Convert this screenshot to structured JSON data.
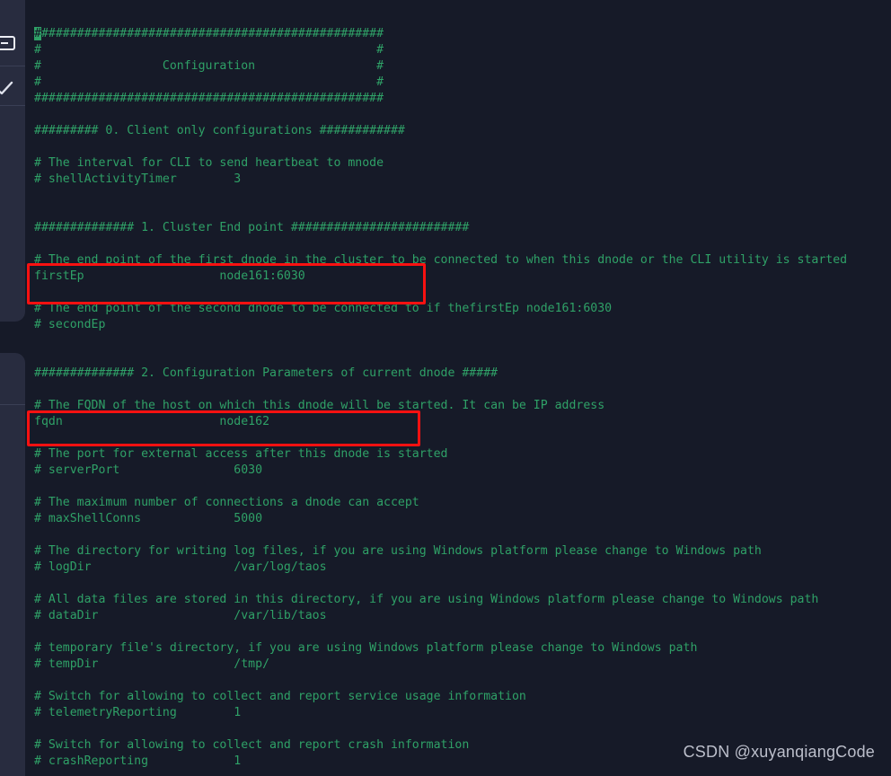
{
  "window": {
    "background_color": "#161a28",
    "sidebar_color": "#282c3f",
    "code_color": "#2fa167",
    "annotation_color": "#f91111"
  },
  "sidebar": {
    "icons": [
      {
        "name": "window-icon",
        "glyph": "window"
      },
      {
        "name": "checkmark-icon",
        "glyph": "check"
      }
    ]
  },
  "editor": {
    "language": "ini",
    "file_kind": "taos-configuration",
    "cursor": {
      "line": 1,
      "column": 1,
      "char": "#"
    },
    "lines": [
      "#################################################",
      "#                                               #",
      "#                 Configuration                 #",
      "#                                               #",
      "#################################################",
      "",
      "######### 0. Client only configurations ############",
      "",
      "# The interval for CLI to send heartbeat to mnode",
      "# shellActivityTimer        3",
      "",
      "",
      "############## 1. Cluster End point #########################",
      "",
      "# The end point of the first dnode in the cluster to be connected to when this dnode or the CLI utility is started",
      "firstEp                   node161:6030",
      "",
      "# The end point of the second dnode to be connected to if thefirstEp node161:6030",
      "# secondEp",
      "",
      "",
      "############## 2. Configuration Parameters of current dnode #####",
      "",
      "# The FQDN of the host on which this dnode will be started. It can be IP address",
      "fqdn                      node162",
      "",
      "# The port for external access after this dnode is started",
      "# serverPort                6030",
      "",
      "# The maximum number of connections a dnode can accept",
      "# maxShellConns             5000",
      "",
      "# The directory for writing log files, if you are using Windows platform please change to Windows path",
      "# logDir                    /var/log/taos",
      "",
      "# All data files are stored in this directory, if you are using Windows platform please change to Windows path",
      "# dataDir                   /var/lib/taos",
      "",
      "# temporary file's directory, if you are using Windows platform please change to Windows path",
      "# tempDir                   /tmp/",
      "",
      "# Switch for allowing to collect and report service usage information",
      "# telemetryReporting        1",
      "",
      "# Switch for allowing to collect and report crash information",
      "# crashReporting            1"
    ]
  },
  "annotations": [
    {
      "name": "firstEp-highlight",
      "target_key": "firstEp",
      "target_value": "node161:6030",
      "color": "#f91111"
    },
    {
      "name": "fqdn-highlight",
      "target_key": "fqdn",
      "target_value": "node162",
      "color": "#f91111"
    }
  ],
  "watermark": {
    "text": "CSDN @xuyanqiangCode"
  }
}
